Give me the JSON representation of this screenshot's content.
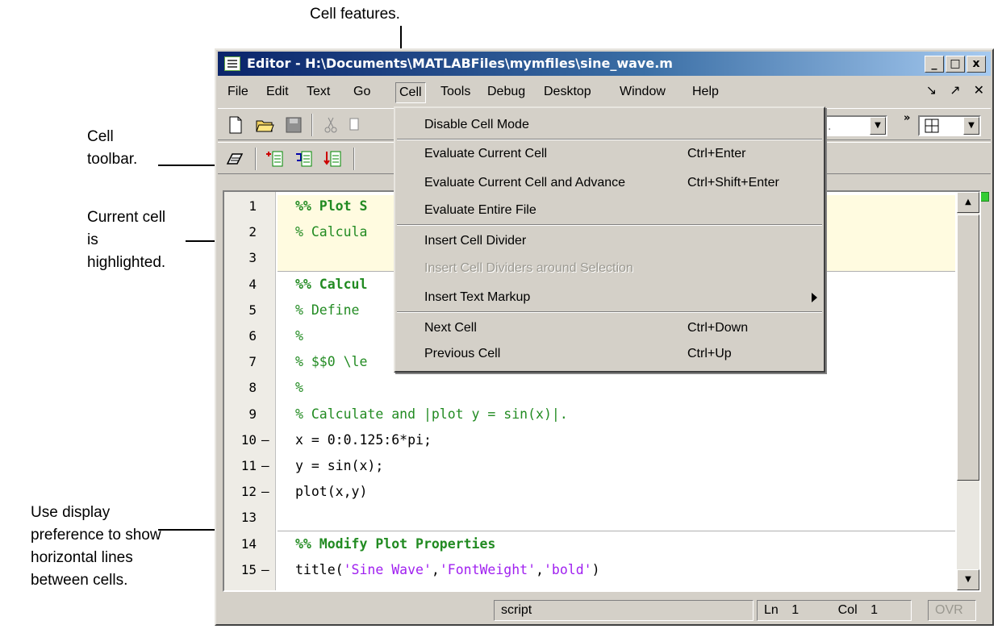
{
  "callouts": {
    "cell_features": "Cell features.",
    "cell_toolbar": [
      "Cell",
      "toolbar."
    ],
    "current_cell": [
      "Current cell",
      "is",
      "highlighted."
    ],
    "display_pref": [
      "Use display",
      "preference to show",
      "horizontal lines",
      "between cells."
    ]
  },
  "window": {
    "title": "Editor - H:\\Documents\\MATLABFiles\\mymfiles\\sine_wave.m",
    "controls": [
      "_",
      "□",
      "x"
    ]
  },
  "menubar": {
    "items": [
      "File",
      "Edit",
      "Text",
      "Go",
      "Cell",
      "Tools",
      "Debug",
      "Desktop",
      "Window",
      "Help"
    ],
    "active": "Cell",
    "right_controls": [
      "↘",
      "↗",
      "✕"
    ]
  },
  "toolbar": {
    "combo_text": "B...",
    "icons": [
      "new-file-icon",
      "open-folder-icon",
      "save-icon",
      "cut-icon",
      "copy-icon",
      "layout-grid-icon"
    ]
  },
  "cell_toolbar": {
    "icons": [
      "cell-eraser-icon",
      "insert-cell-divider-icon",
      "evaluate-cell-icon",
      "evaluate-advance-icon"
    ]
  },
  "editor": {
    "line_numbers": [
      "1",
      "2",
      "3",
      "4",
      "5",
      "6",
      "7",
      "8",
      "9",
      "10",
      "11",
      "12",
      "13",
      "14",
      "15"
    ],
    "executable_lines": [
      10,
      11,
      12,
      15
    ],
    "lines": [
      {
        "type": "cb",
        "text": "%% Plot S"
      },
      {
        "type": "cm",
        "text": "% Calcula"
      },
      {
        "type": "cm",
        "text": ""
      },
      {
        "type": "cb",
        "text": "%% Calcul"
      },
      {
        "type": "cm",
        "text": "% Define "
      },
      {
        "type": "cm",
        "text": "%"
      },
      {
        "type": "cm",
        "text": "% $$0 \\le"
      },
      {
        "type": "cm",
        "text": "%"
      },
      {
        "type": "cm",
        "text": "% Calculate and |plot y = sin(x)|."
      },
      {
        "type": "code",
        "text": "x = 0:0.125:6*pi;"
      },
      {
        "type": "code",
        "text": "y = sin(x);"
      },
      {
        "type": "code",
        "text": "plot(x,y)"
      },
      {
        "type": "code",
        "text": ""
      },
      {
        "type": "cb",
        "text": "%% Modify Plot Properties"
      },
      {
        "type": "mixed",
        "parts": [
          "title(",
          "'Sine Wave'",
          ",",
          "'FontWeight'",
          ",",
          "'bold'",
          ")"
        ]
      }
    ]
  },
  "cell_menu": {
    "items": [
      {
        "label": "Disable Cell Mode",
        "shortcut": ""
      },
      {
        "label": "Evaluate Current Cell",
        "shortcut": "Ctrl+Enter"
      },
      {
        "label": "Evaluate Current Cell and Advance",
        "shortcut": "Ctrl+Shift+Enter"
      },
      {
        "label": "Evaluate Entire File",
        "shortcut": ""
      },
      {
        "label": "Insert Cell Divider",
        "shortcut": ""
      },
      {
        "label": "Insert Cell Dividers around Selection",
        "shortcut": ""
      },
      {
        "label": "Insert Text Markup",
        "shortcut": ""
      },
      {
        "label": "Next Cell",
        "shortcut": "Ctrl+Down"
      },
      {
        "label": "Previous Cell",
        "shortcut": "Ctrl+Up"
      }
    ]
  },
  "statusbar": {
    "mode": "script",
    "ln_label": "Ln",
    "ln_value": "1",
    "col_label": "Col",
    "col_value": "1",
    "ovr": "OVR"
  }
}
